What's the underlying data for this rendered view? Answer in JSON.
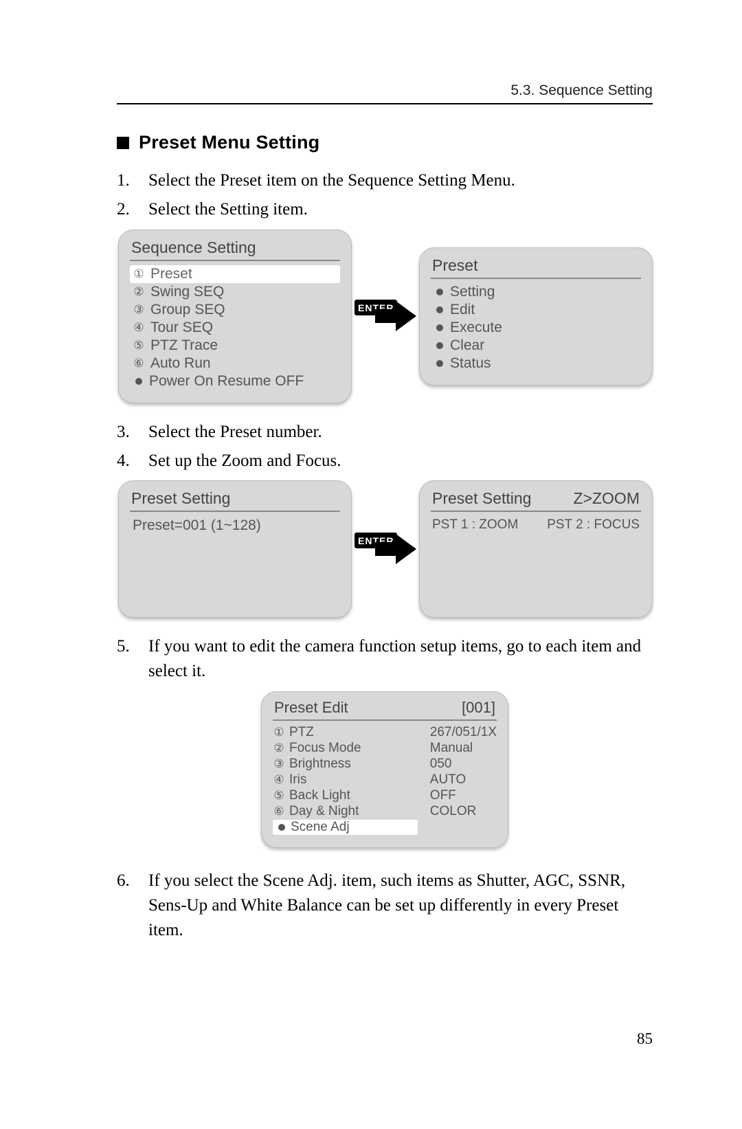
{
  "header": {
    "running": "5.3. Sequence Setting"
  },
  "heading": {
    "title": "Preset Menu Setting"
  },
  "steps": {
    "s1": "Select the Preset item on the Sequence Setting Menu.",
    "s2": "Select the Setting item.",
    "s3": "Select the Preset number.",
    "s4": "Set up the Zoom and Focus.",
    "s5": "If you want to edit the camera function setup items, go to each item and select it.",
    "s6": "If you select the Scene Adj. item, such items as Shutter, AGC, SSNR, Sens-Up and White Balance can be set up differently in every Preset item."
  },
  "enter": {
    "label": "ENTER"
  },
  "menus": {
    "sequence": {
      "title": "Sequence Setting",
      "items": [
        "Preset",
        "Swing SEQ",
        "Group SEQ",
        "Tour SEQ",
        "PTZ Trace",
        "Auto Run",
        "Power On Resume OFF"
      ]
    },
    "preset": {
      "title": "Preset",
      "items": [
        "Setting",
        "Edit",
        "Execute",
        "Clear",
        "Status"
      ]
    },
    "preset_setting_left": {
      "title": "Preset Setting",
      "line": "Preset=001 (1~128)"
    },
    "preset_setting_right": {
      "title": "Preset Setting",
      "title_right": "Z>ZOOM",
      "sub_left": "PST 1 : ZOOM",
      "sub_right": "PST 2 : FOCUS"
    },
    "preset_edit": {
      "title": "Preset Edit",
      "title_right": "[001]",
      "rows": [
        {
          "label": "PTZ",
          "value": "267/051/1X"
        },
        {
          "label": "Focus Mode",
          "value": "Manual"
        },
        {
          "label": "Brightness",
          "value": "050"
        },
        {
          "label": "Iris",
          "value": "AUTO"
        },
        {
          "label": "Back Light",
          "value": "OFF"
        },
        {
          "label": "Day & Night",
          "value": "COLOR"
        },
        {
          "label": "Scene Adj",
          "value": ""
        }
      ]
    }
  },
  "footer": {
    "page": "85"
  },
  "circled": [
    "①",
    "②",
    "③",
    "④",
    "⑤",
    "⑥"
  ]
}
